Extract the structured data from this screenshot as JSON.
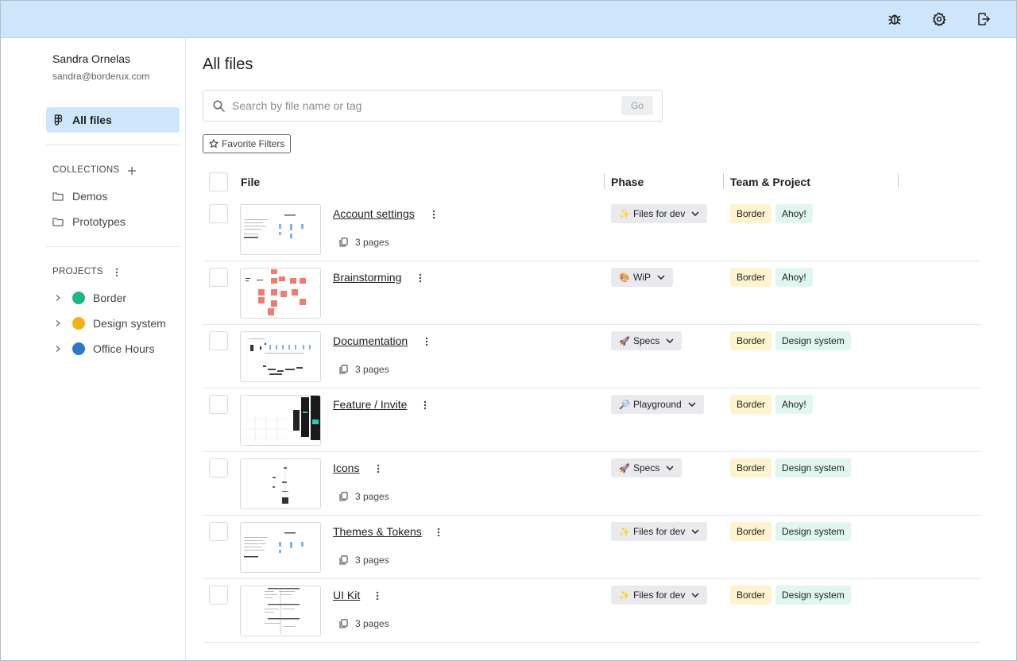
{
  "colors": {
    "topbar": "#cde6fb",
    "active_nav": "#cde6fb",
    "team_tag": "#fdf3cd",
    "project_tag": "#dff7ee",
    "phase_bg": "#e8eaed"
  },
  "topbar": {
    "icons": [
      "bug-icon",
      "gear-icon",
      "logout-icon"
    ]
  },
  "user": {
    "name": "Sandra Ornelas",
    "email": "sandra@borderux.com"
  },
  "nav": {
    "all_files_label": "All files",
    "all_files_icon": "figma-icon"
  },
  "collections": {
    "title": "COLLECTIONS",
    "items": [
      {
        "label": "Demos",
        "icon": "folder-icon"
      },
      {
        "label": "Prototypes",
        "icon": "folder-icon"
      }
    ]
  },
  "projects": {
    "title": "PROJECTS",
    "items": [
      {
        "label": "Border",
        "color": "#1fb784"
      },
      {
        "label": "Design system",
        "color": "#f2b01c"
      },
      {
        "label": "Office Hours",
        "color": "#2a78c9"
      }
    ]
  },
  "main": {
    "title": "All files",
    "search_placeholder": "Search by file name or tag",
    "go_label": "Go",
    "favorite_filters_label": "Favorite Filters"
  },
  "table": {
    "columns": [
      "File",
      "Phase",
      "Team & Project"
    ],
    "rows": [
      {
        "name": "Account settings",
        "pages": "3 pages",
        "phase": "Files for dev",
        "phase_emoji": "✨",
        "team": "Border",
        "project": "Ahoy!"
      },
      {
        "name": "Brainstorming",
        "pages": "",
        "phase": "WiP",
        "phase_emoji": "🎨",
        "team": "Border",
        "project": "Ahoy!"
      },
      {
        "name": "Documentation",
        "pages": "3 pages",
        "phase": "Specs",
        "phase_emoji": "🚀",
        "team": "Border",
        "project": "Design system"
      },
      {
        "name": "Feature / Invite",
        "pages": "",
        "phase": "Playground",
        "phase_emoji": "🔎",
        "team": "Border",
        "project": "Ahoy!"
      },
      {
        "name": "Icons",
        "pages": "3 pages",
        "phase": "Specs",
        "phase_emoji": "🚀",
        "team": "Border",
        "project": "Design system"
      },
      {
        "name": "Themes & Tokens",
        "pages": "3 pages",
        "phase": "Files for dev",
        "phase_emoji": "✨",
        "team": "Border",
        "project": "Design system"
      },
      {
        "name": "UI Kit",
        "pages": "3 pages",
        "phase": "Files for dev",
        "phase_emoji": "✨",
        "team": "Border",
        "project": "Design system"
      }
    ]
  }
}
